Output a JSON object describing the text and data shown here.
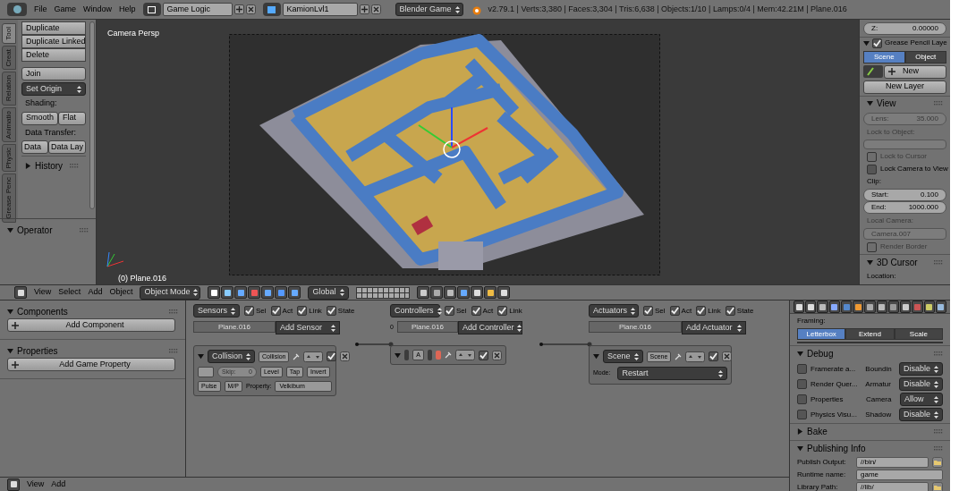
{
  "top_bar": {
    "menus": [
      "File",
      "Game",
      "Window",
      "Help"
    ],
    "screen": "Game Logic",
    "scene": "KamionLvl1",
    "engine": "Blender Game",
    "stats": "v2.79.1 | Verts:3,380 | Faces:3,304 | Tris:6,638 | Objects:1/10 | Lamps:0/4 | Mem:42.21M | Plane.016"
  },
  "tool_shelf": {
    "tabs": [
      {
        "label": "Tool",
        "selected": true
      },
      {
        "label": "Creat",
        "selected": false
      },
      {
        "label": "Relation",
        "selected": false
      },
      {
        "label": "Animatio",
        "selected": false
      },
      {
        "label": "Physic",
        "selected": false
      },
      {
        "label": "Grease Penc",
        "selected": false
      }
    ],
    "edit_buttons": [
      "Duplicate",
      "Duplicate Linked",
      "Delete"
    ],
    "join": "Join",
    "set_origin": "Set Origin",
    "shading_label": "Shading:",
    "shading_buttons": [
      "Smooth",
      "Flat"
    ],
    "transfer_label": "Data Transfer:",
    "transfer_buttons": [
      "Data",
      "Data Lay"
    ],
    "history": {
      "title": "History",
      "expanded": false
    },
    "operator": {
      "title": "Operator",
      "expanded": true
    }
  },
  "viewport": {
    "camera_label": "Camera Persp",
    "object_label": "(0) Plane.016"
  },
  "view3d_header": {
    "menus": [
      "View",
      "Select",
      "Add",
      "Object"
    ],
    "mode": "Object Mode",
    "orientation": "Global"
  },
  "n_panel": {
    "z_field": {
      "label": "Z:",
      "value": "0.00000"
    },
    "grease_pencil": {
      "title": "Grease Pencil Laye",
      "checked": true,
      "tabs": [
        {
          "label": "Scene",
          "selected": true
        },
        {
          "label": "Object",
          "selected": false
        }
      ],
      "new": "New",
      "new_layer": "New Layer"
    },
    "view": {
      "title": "View",
      "expanded": true,
      "lens": {
        "label": "Lens:",
        "value": "35.000"
      },
      "lock_object_label": "Lock to Object:",
      "lock_cursor": {
        "label": "Lock to Cursor",
        "checked": false
      },
      "lock_camera": {
        "label": "Lock Camera to View",
        "checked": false
      },
      "clip_label": "Clip:",
      "start": {
        "label": "Start:",
        "value": "0.100"
      },
      "end": {
        "label": "End:",
        "value": "1000.000"
      },
      "local_camera_label": "Local Camera:",
      "local_camera": "Camera.007",
      "render_border": {
        "label": "Render Border",
        "checked": false
      }
    },
    "cursor": {
      "title": "3D Cursor",
      "expanded": true,
      "location_label": "Location:"
    }
  },
  "logic_sidebar": {
    "components": {
      "title": "Components",
      "expanded": true,
      "button": "Add Component"
    },
    "properties": {
      "title": "Properties",
      "expanded": true,
      "button": "Add Game Property"
    }
  },
  "logic": {
    "sensors": {
      "menu": "Sensors",
      "filters": [
        {
          "label": "Sel",
          "checked": true
        },
        {
          "label": "Act",
          "checked": true
        },
        {
          "label": "Link",
          "checked": true
        },
        {
          "label": "State",
          "checked": true
        }
      ],
      "object": "Plane.016",
      "add": "Add Sensor",
      "brick": {
        "active": true,
        "type": "Collision",
        "name": "Collision",
        "skip_label": "Skip:",
        "skip_value": "0",
        "level": "Level",
        "tap": "Tap",
        "invert": "Invert",
        "pulse": "Pulse",
        "mp": "M/P",
        "property_label": "Property:",
        "property_value": "Velkibum"
      }
    },
    "controllers": {
      "menu": "Controllers",
      "filters": [
        {
          "label": "Sel",
          "checked": true
        },
        {
          "label": "Act",
          "checked": true
        },
        {
          "label": "Link",
          "checked": true
        }
      ],
      "state": "0",
      "object": "Plane.016",
      "add": "Add Controller",
      "brick": {
        "active": true,
        "type": "A"
      }
    },
    "actuators": {
      "menu": "Actuators",
      "filters": [
        {
          "label": "Sel",
          "checked": true
        },
        {
          "label": "Act",
          "checked": true
        },
        {
          "label": "Link",
          "checked": true
        },
        {
          "label": "State",
          "checked": true
        }
      ],
      "object": "Plane.016",
      "add": "Add Actuator",
      "brick": {
        "active": true,
        "type": "Scene",
        "name": "Scene",
        "mode_label": "Mode:",
        "mode": "Restart"
      }
    }
  },
  "render_props": {
    "framing_label": "Framing:",
    "framing": [
      {
        "label": "Letterbox",
        "selected": true
      },
      {
        "label": "Extend",
        "selected": false
      },
      {
        "label": "Scale",
        "selected": false
      }
    ],
    "debug": {
      "title": "Debug",
      "expanded": true,
      "rows": [
        {
          "label": "Framerate a...",
          "checked": false,
          "setting": "Boundin",
          "value": "Disable"
        },
        {
          "label": "Render Quer...",
          "checked": false,
          "setting": "Armatur",
          "value": "Disable"
        },
        {
          "label": "Properties",
          "checked": false,
          "setting": "Camera",
          "value": "Allow"
        },
        {
          "label": "Physics Visu...",
          "checked": false,
          "setting": "Shadow",
          "value": "Disable"
        }
      ]
    },
    "bake": {
      "title": "Bake",
      "expanded": false
    },
    "publishing": {
      "title": "Publishing Info",
      "expanded": true,
      "fields": [
        {
          "label": "Publish Output:",
          "value": "//bin/",
          "folder": true
        },
        {
          "label": "Runtime name:",
          "value": "game",
          "folder": false
        },
        {
          "label": "Library Path:",
          "value": "//lib/",
          "folder": true
        }
      ]
    }
  },
  "bottom_header": {
    "menus": [
      "View",
      "Add"
    ]
  }
}
